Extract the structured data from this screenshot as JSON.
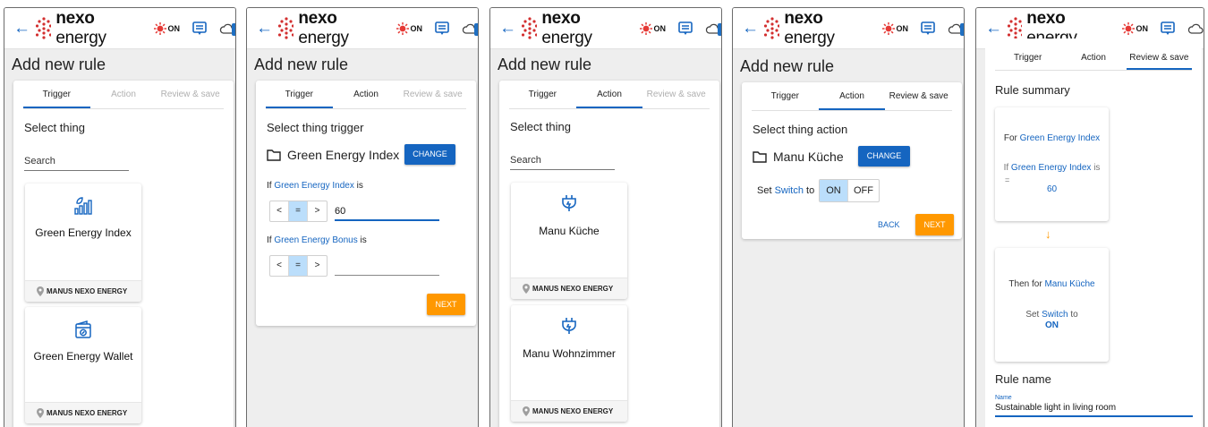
{
  "app": {
    "brand_bold": "nexo",
    "brand_rest": " energy",
    "on_badge": "ON",
    "back_symbol": "←"
  },
  "colors": {
    "primary": "#1565c0",
    "accent": "#ff9800",
    "logo_red": "#d32f2f",
    "selected": "#bbdefb"
  },
  "screens": {
    "s1": {
      "title": "Add new rule",
      "tabs": [
        "Trigger",
        "Action",
        "Review & save"
      ],
      "heading": "Select thing",
      "search_label": "Search",
      "things": [
        {
          "name": "Green Energy Index",
          "icon": "bar-chart-leaf-icon",
          "owner": "MANUS NEXO ENERGY"
        },
        {
          "name": "Green Energy Wallet",
          "icon": "wallet-leaf-icon",
          "owner": "MANUS NEXO ENERGY"
        }
      ]
    },
    "s2": {
      "title": "Add new rule",
      "tabs": [
        "Trigger",
        "Action",
        "Review & save"
      ],
      "heading": "Select thing trigger",
      "thing_name": "Green Energy Index",
      "change_label": "CHANGE",
      "cond1_prefix": "If ",
      "cond1_link": "Green Energy Index",
      "cond1_suffix": " is",
      "cond1_ops": [
        "<",
        "=",
        ">"
      ],
      "cond1_value": "60",
      "cond2_prefix": "If ",
      "cond2_link": "Green Energy Bonus",
      "cond2_suffix": " is",
      "cond2_ops": [
        "<",
        "=",
        ">"
      ],
      "cond2_value": "",
      "next_label": "NEXT"
    },
    "s3": {
      "title": "Add new rule",
      "tabs": [
        "Trigger",
        "Action",
        "Review & save"
      ],
      "heading": "Select thing",
      "search_label": "Search",
      "things": [
        {
          "name": "Manu Küche",
          "icon": "plug-icon",
          "owner": "MANUS NEXO ENERGY"
        },
        {
          "name": "Manu Wohnzimmer",
          "icon": "plug-icon",
          "owner": "MANUS NEXO ENERGY"
        }
      ]
    },
    "s4": {
      "title": "Add new rule",
      "tabs": [
        "Trigger",
        "Action",
        "Review & save"
      ],
      "heading": "Select thing action",
      "thing_name": "Manu Küche",
      "change_label": "CHANGE",
      "set_prefix": "Set ",
      "set_link": "Switch",
      "set_suffix": " to",
      "toggle": [
        "ON",
        "OFF"
      ],
      "back_label": "BACK",
      "next_label": "NEXT"
    },
    "s5": {
      "tabs": [
        "Trigger",
        "Action",
        "Review & save"
      ],
      "summary_heading": "Rule summary",
      "for_prefix": "For ",
      "for_link": "Green Energy Index",
      "if_prefix": "If ",
      "if_link": "Green Energy Index",
      "if_suffix": " is",
      "op": "=",
      "value": "60",
      "arrow": "↓",
      "then_prefix": "Then for ",
      "then_link": "Manu Küche",
      "set_prefix": "Set ",
      "set_link": "Switch",
      "set_suffix": " to",
      "set_value": "ON",
      "rule_name_heading": "Rule name",
      "name_label": "Name",
      "name_value": "Sustainable light in living room"
    }
  }
}
